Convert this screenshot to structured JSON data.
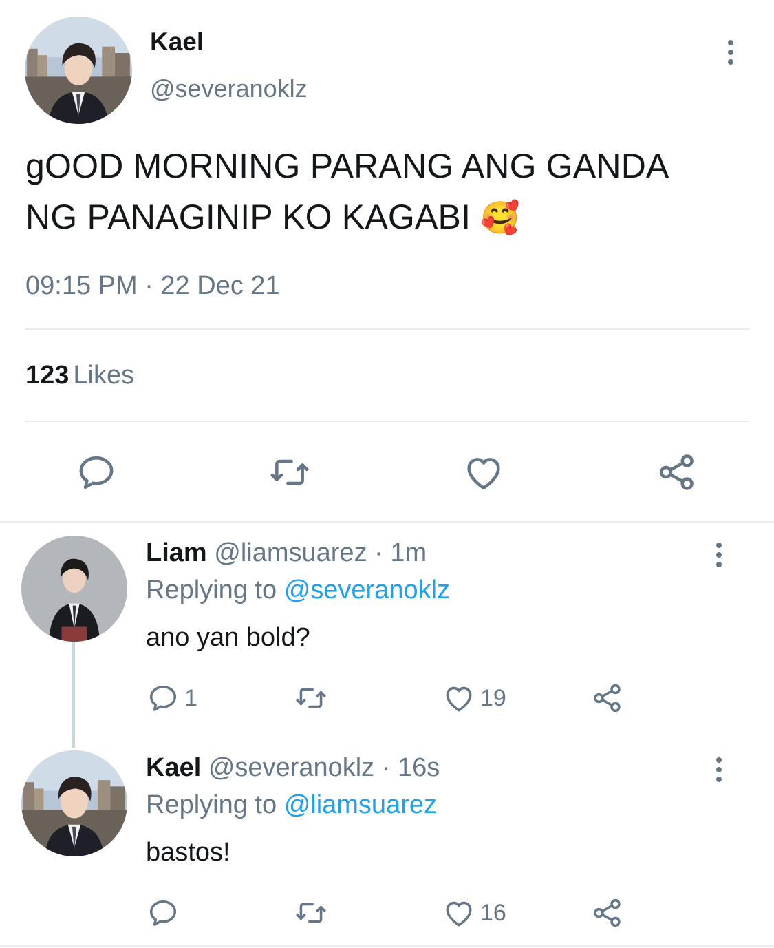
{
  "colors": {
    "text": "#14171a",
    "secondary": "#657786",
    "link": "#1da1f2",
    "divider": "#e6ecf0",
    "thread_line": "#ccd6dd",
    "icon": "#657786"
  },
  "main_tweet": {
    "name": "Kael",
    "handle": "@severanoklz",
    "text_line1": "gOOD MORNING PARANG ANG GANDA",
    "text_line2": "NG PANAGINIP KO KAGABI",
    "emoji": "🥰",
    "timestamp": "09:15 PM · 22 Dec 21",
    "likes_count": "123",
    "likes_label": "Likes",
    "icons": {
      "more": "more-vertical-icon",
      "reply": "reply-icon",
      "retweet": "retweet-icon",
      "like": "heart-icon",
      "share": "share-icon"
    }
  },
  "replies": [
    {
      "name": "Liam",
      "handle": "@liamsuarez",
      "separator": "·",
      "time": "1m",
      "replying_prefix": "Replying to",
      "replying_to": "@severanoklz",
      "text": "ano yan bold?",
      "reply_count": "1",
      "retweet_count": "",
      "like_count": "19"
    },
    {
      "name": "Kael",
      "handle": "@severanoklz",
      "separator": "·",
      "time": "16s",
      "replying_prefix": "Replying to",
      "replying_to": "@liamsuarez",
      "text": "bastos!",
      "reply_count": "",
      "retweet_count": "",
      "like_count": "16"
    }
  ]
}
